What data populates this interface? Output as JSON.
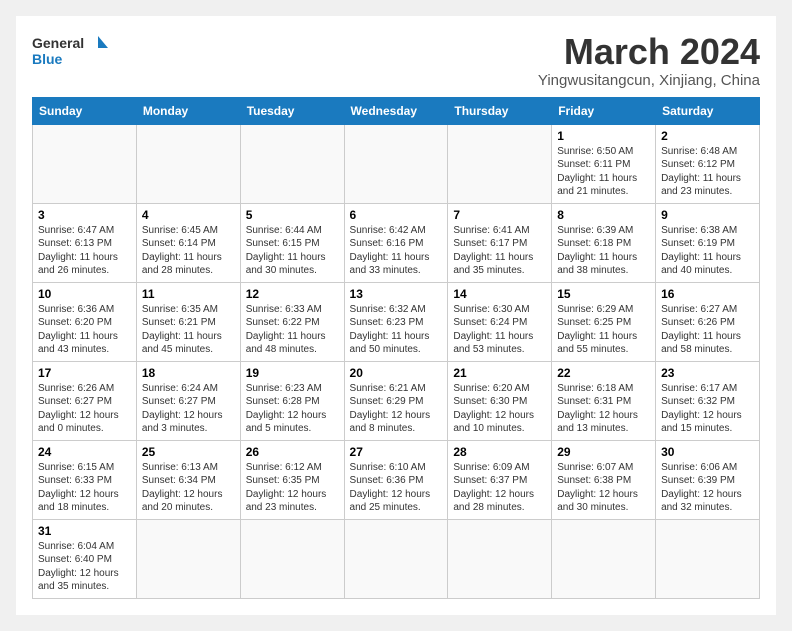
{
  "logo": {
    "text_general": "General",
    "text_blue": "Blue"
  },
  "title": "March 2024",
  "subtitle": "Yingwusitangcun, Xinjiang, China",
  "weekdays": [
    "Sunday",
    "Monday",
    "Tuesday",
    "Wednesday",
    "Thursday",
    "Friday",
    "Saturday"
  ],
  "weeks": [
    [
      {
        "num": "",
        "info": ""
      },
      {
        "num": "",
        "info": ""
      },
      {
        "num": "",
        "info": ""
      },
      {
        "num": "",
        "info": ""
      },
      {
        "num": "",
        "info": ""
      },
      {
        "num": "1",
        "info": "Sunrise: 6:50 AM\nSunset: 6:11 PM\nDaylight: 11 hours and 21 minutes."
      },
      {
        "num": "2",
        "info": "Sunrise: 6:48 AM\nSunset: 6:12 PM\nDaylight: 11 hours and 23 minutes."
      }
    ],
    [
      {
        "num": "3",
        "info": "Sunrise: 6:47 AM\nSunset: 6:13 PM\nDaylight: 11 hours and 26 minutes."
      },
      {
        "num": "4",
        "info": "Sunrise: 6:45 AM\nSunset: 6:14 PM\nDaylight: 11 hours and 28 minutes."
      },
      {
        "num": "5",
        "info": "Sunrise: 6:44 AM\nSunset: 6:15 PM\nDaylight: 11 hours and 30 minutes."
      },
      {
        "num": "6",
        "info": "Sunrise: 6:42 AM\nSunset: 6:16 PM\nDaylight: 11 hours and 33 minutes."
      },
      {
        "num": "7",
        "info": "Sunrise: 6:41 AM\nSunset: 6:17 PM\nDaylight: 11 hours and 35 minutes."
      },
      {
        "num": "8",
        "info": "Sunrise: 6:39 AM\nSunset: 6:18 PM\nDaylight: 11 hours and 38 minutes."
      },
      {
        "num": "9",
        "info": "Sunrise: 6:38 AM\nSunset: 6:19 PM\nDaylight: 11 hours and 40 minutes."
      }
    ],
    [
      {
        "num": "10",
        "info": "Sunrise: 6:36 AM\nSunset: 6:20 PM\nDaylight: 11 hours and 43 minutes."
      },
      {
        "num": "11",
        "info": "Sunrise: 6:35 AM\nSunset: 6:21 PM\nDaylight: 11 hours and 45 minutes."
      },
      {
        "num": "12",
        "info": "Sunrise: 6:33 AM\nSunset: 6:22 PM\nDaylight: 11 hours and 48 minutes."
      },
      {
        "num": "13",
        "info": "Sunrise: 6:32 AM\nSunset: 6:23 PM\nDaylight: 11 hours and 50 minutes."
      },
      {
        "num": "14",
        "info": "Sunrise: 6:30 AM\nSunset: 6:24 PM\nDaylight: 11 hours and 53 minutes."
      },
      {
        "num": "15",
        "info": "Sunrise: 6:29 AM\nSunset: 6:25 PM\nDaylight: 11 hours and 55 minutes."
      },
      {
        "num": "16",
        "info": "Sunrise: 6:27 AM\nSunset: 6:26 PM\nDaylight: 11 hours and 58 minutes."
      }
    ],
    [
      {
        "num": "17",
        "info": "Sunrise: 6:26 AM\nSunset: 6:27 PM\nDaylight: 12 hours and 0 minutes."
      },
      {
        "num": "18",
        "info": "Sunrise: 6:24 AM\nSunset: 6:27 PM\nDaylight: 12 hours and 3 minutes."
      },
      {
        "num": "19",
        "info": "Sunrise: 6:23 AM\nSunset: 6:28 PM\nDaylight: 12 hours and 5 minutes."
      },
      {
        "num": "20",
        "info": "Sunrise: 6:21 AM\nSunset: 6:29 PM\nDaylight: 12 hours and 8 minutes."
      },
      {
        "num": "21",
        "info": "Sunrise: 6:20 AM\nSunset: 6:30 PM\nDaylight: 12 hours and 10 minutes."
      },
      {
        "num": "22",
        "info": "Sunrise: 6:18 AM\nSunset: 6:31 PM\nDaylight: 12 hours and 13 minutes."
      },
      {
        "num": "23",
        "info": "Sunrise: 6:17 AM\nSunset: 6:32 PM\nDaylight: 12 hours and 15 minutes."
      }
    ],
    [
      {
        "num": "24",
        "info": "Sunrise: 6:15 AM\nSunset: 6:33 PM\nDaylight: 12 hours and 18 minutes."
      },
      {
        "num": "25",
        "info": "Sunrise: 6:13 AM\nSunset: 6:34 PM\nDaylight: 12 hours and 20 minutes."
      },
      {
        "num": "26",
        "info": "Sunrise: 6:12 AM\nSunset: 6:35 PM\nDaylight: 12 hours and 23 minutes."
      },
      {
        "num": "27",
        "info": "Sunrise: 6:10 AM\nSunset: 6:36 PM\nDaylight: 12 hours and 25 minutes."
      },
      {
        "num": "28",
        "info": "Sunrise: 6:09 AM\nSunset: 6:37 PM\nDaylight: 12 hours and 28 minutes."
      },
      {
        "num": "29",
        "info": "Sunrise: 6:07 AM\nSunset: 6:38 PM\nDaylight: 12 hours and 30 minutes."
      },
      {
        "num": "30",
        "info": "Sunrise: 6:06 AM\nSunset: 6:39 PM\nDaylight: 12 hours and 32 minutes."
      }
    ],
    [
      {
        "num": "31",
        "info": "Sunrise: 6:04 AM\nSunset: 6:40 PM\nDaylight: 12 hours and 35 minutes."
      },
      {
        "num": "",
        "info": ""
      },
      {
        "num": "",
        "info": ""
      },
      {
        "num": "",
        "info": ""
      },
      {
        "num": "",
        "info": ""
      },
      {
        "num": "",
        "info": ""
      },
      {
        "num": "",
        "info": ""
      }
    ]
  ]
}
